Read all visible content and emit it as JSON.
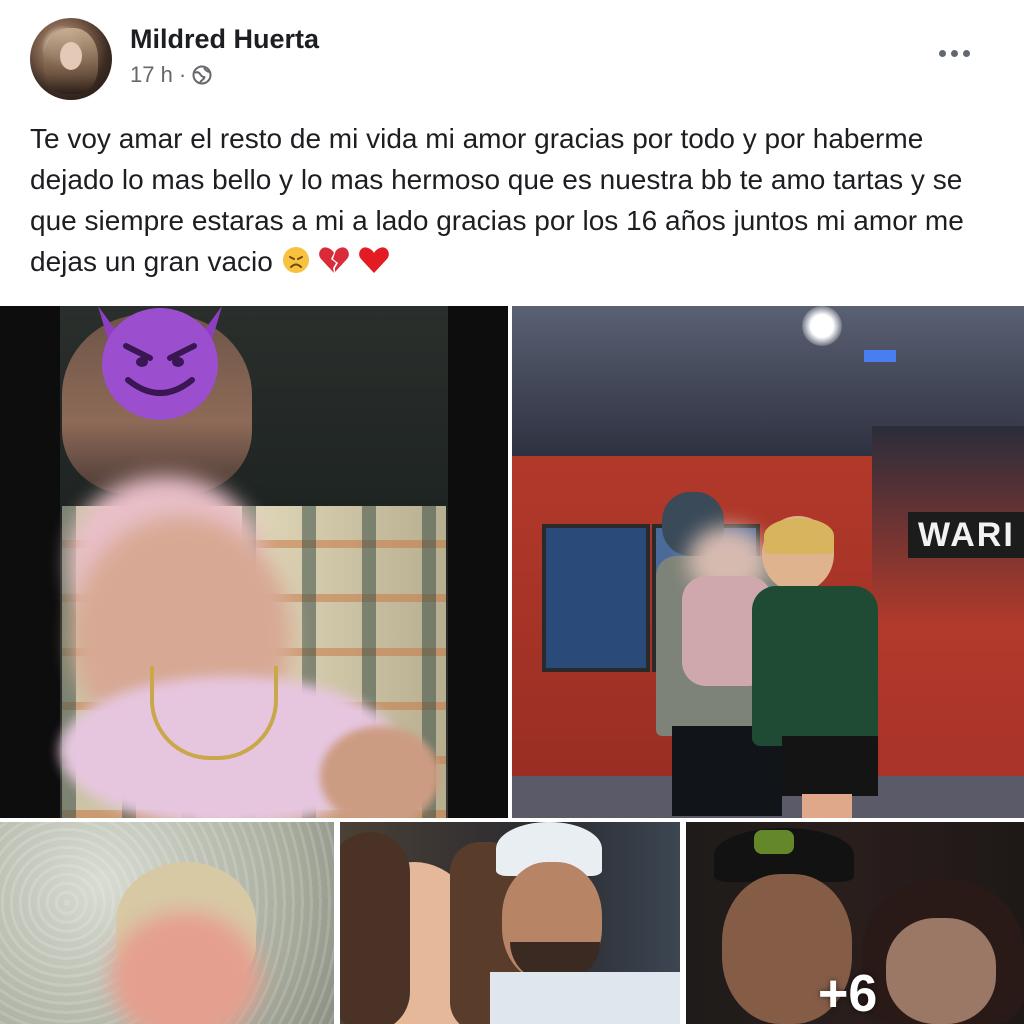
{
  "post": {
    "author": "Mildred Huerta",
    "time": "17 h",
    "separator": "·",
    "audience_icon": "globe-icon",
    "more_icon": "more-options-icon",
    "text": "Te voy amar el resto de mi vida mi amor gracias por todo y por haberme dejado lo mas bello y lo mas hermoso que es nuestra bb te amo tartas y se que siempre estaras a mi a lado gracias por los 16 años juntos mi amor me dejas un gran vacio",
    "emojis": [
      "disappointed-face-icon",
      "broken-heart-icon",
      "red-heart-icon"
    ]
  },
  "gallery": {
    "photos": [
      {
        "name": "photo-1"
      },
      {
        "name": "photo-2",
        "sign_text": "WARI"
      },
      {
        "name": "photo-3"
      },
      {
        "name": "photo-4"
      },
      {
        "name": "photo-5"
      }
    ],
    "more_count": "+6"
  }
}
